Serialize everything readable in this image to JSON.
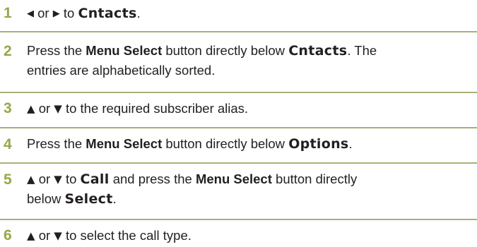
{
  "steps": [
    {
      "number": "1",
      "left_arrow": "◀",
      "or": "or",
      "right_arrow": "▶",
      "to": "to",
      "target": "Cntacts",
      "end": "."
    },
    {
      "number": "2",
      "press": "Press the",
      "button": "Menu Select",
      "middle": "button directly below",
      "target": "Cntacts",
      "rest": ". The",
      "line2": "entries are alphabetically sorted."
    },
    {
      "number": "3",
      "up_arrow": "▲",
      "or": "or",
      "down_arrow": "▼",
      "rest": "to the required subscriber alias."
    },
    {
      "number": "4",
      "press": "Press the",
      "button": "Menu Select",
      "middle": "button directly below",
      "target": "Options",
      "end": "."
    },
    {
      "number": "5",
      "up_arrow": "▲",
      "or": "or",
      "down_arrow": "▼",
      "to": "to",
      "target": "Call",
      "middle": "and press the",
      "button": "Menu Select",
      "rest": "button directly",
      "line2_below": "below",
      "line2_target": "Select",
      "end": "."
    },
    {
      "number": "6",
      "up_arrow": "▲",
      "or": "or",
      "down_arrow": "▼",
      "rest": "to select the call type."
    }
  ],
  "colors": {
    "step_number": "#9aa548",
    "divider": "#a8b07a",
    "text": "#231f20"
  }
}
